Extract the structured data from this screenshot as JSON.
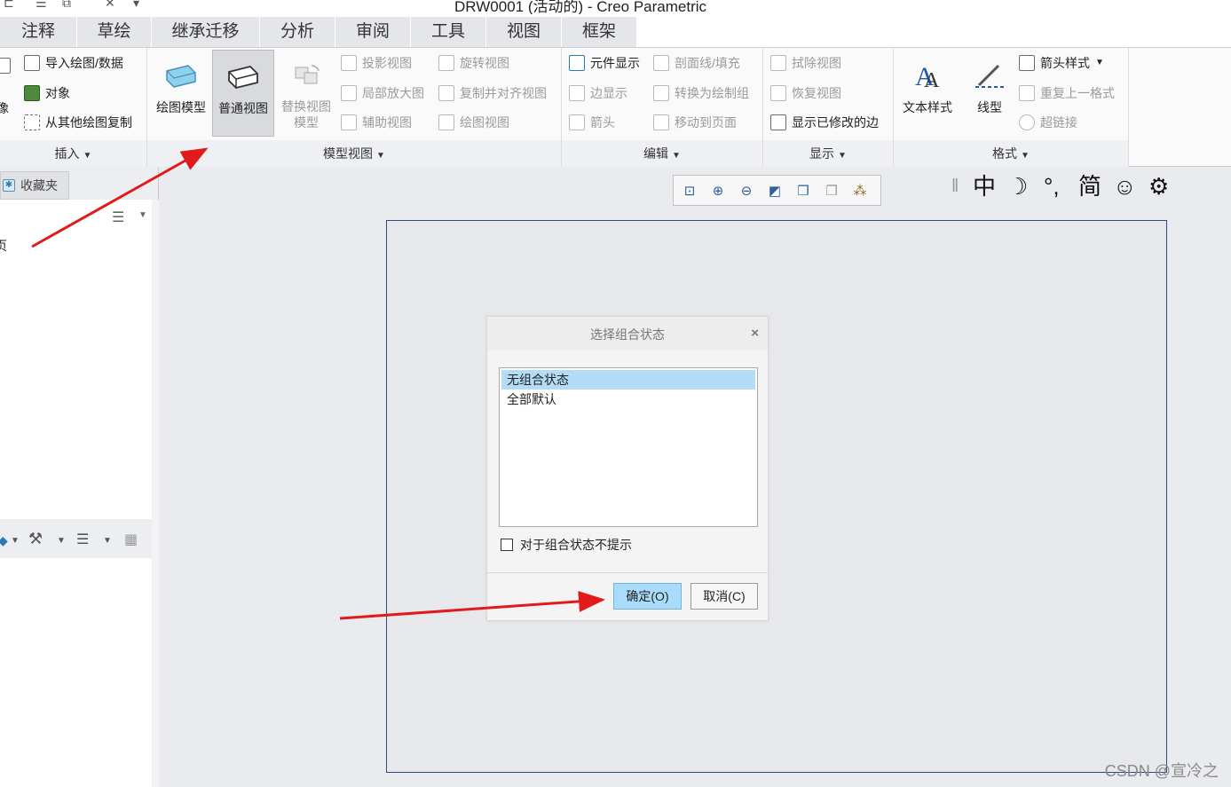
{
  "window": {
    "title": "DRW0001 (活动的) - Creo Parametric"
  },
  "tabs": [
    "注释",
    "草绘",
    "继承迁移",
    "分析",
    "审阅",
    "工具",
    "视图",
    "框架"
  ],
  "ribbon": {
    "insert": {
      "items": [
        "像",
        "导入绘图/数据",
        "对象",
        "从其他绘图复制"
      ],
      "footer": "插入"
    },
    "model_views": {
      "big_buttons": [
        "绘图模型",
        "普通视图",
        "替换视图模型"
      ],
      "items": [
        "投影视图",
        "旋转视图",
        "局部放大图",
        "复制并对齐视图",
        "辅助视图",
        "绘图视图"
      ],
      "footer": "模型视图"
    },
    "edit": {
      "items": [
        "元件显示",
        "剖面线/填充",
        "边显示",
        "转换为绘制组",
        "箭头",
        "移动到页面"
      ],
      "footer": "编辑"
    },
    "display": {
      "items": [
        "拭除视图",
        "恢复视图",
        "显示已修改的边"
      ],
      "footer": "显示"
    },
    "format": {
      "big_buttons": [
        "文本样式",
        "线型"
      ],
      "items": [
        "箭头样式",
        "重复上一格式",
        "超链接"
      ],
      "footer": "格式"
    }
  },
  "left_panel": {
    "tab_label": "收藏夹",
    "truncated_item": "页"
  },
  "ime_bar": [
    "中",
    "☽",
    "°,",
    "简",
    "☺",
    "⚙"
  ],
  "dialog": {
    "title": "选择组合状态",
    "close": "×",
    "options": [
      "无组合状态",
      "全部默认"
    ],
    "selected_index": 0,
    "checkbox_label": "对于组合状态不提示",
    "checkbox_checked": false,
    "ok_label": "确定(O)",
    "cancel_label": "取消(C)"
  },
  "watermark": "CSDN @宣冷之",
  "colors": {
    "accent": "#a9dcfa",
    "selection": "#b4dcf7",
    "arrow": "#e01b1b",
    "sheet_border": "#2a4b86"
  }
}
